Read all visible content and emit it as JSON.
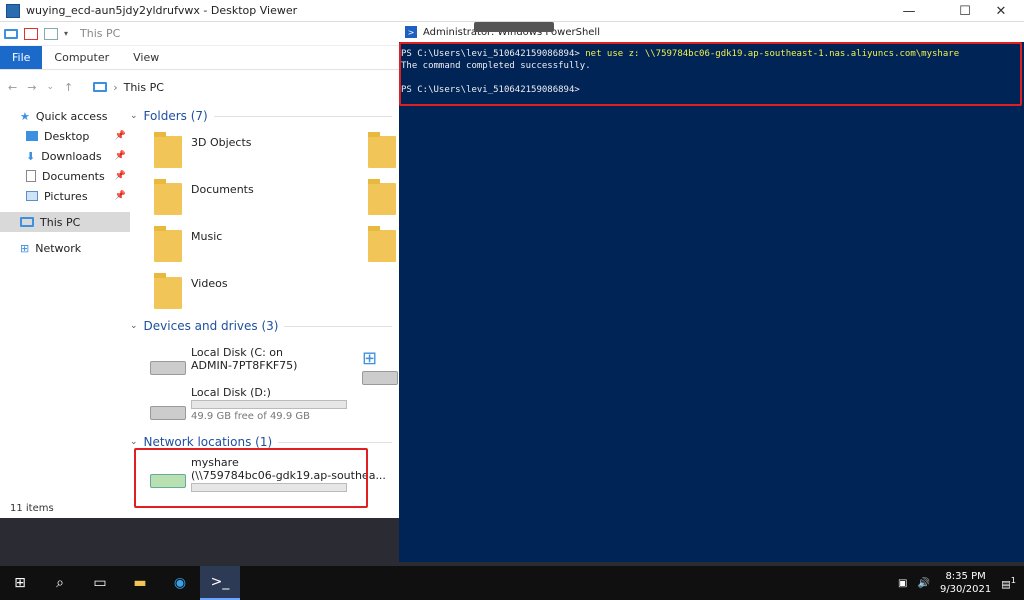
{
  "viewer": {
    "title": "wuying_ecd-aun5jdy2yldrufvwx - Desktop Viewer"
  },
  "explorer": {
    "title": "This PC",
    "ribbon": [
      "File",
      "Computer",
      "View"
    ],
    "address": "This PC",
    "nav": [
      {
        "label": "Quick access",
        "icon": "star-icon",
        "pinned": false
      },
      {
        "label": "Desktop",
        "icon": "desktop-icon",
        "pinned": true
      },
      {
        "label": "Downloads",
        "icon": "download-icon",
        "pinned": true
      },
      {
        "label": "Documents",
        "icon": "documents-icon",
        "pinned": true
      },
      {
        "label": "Pictures",
        "icon": "pictures-icon",
        "pinned": true
      },
      {
        "label": "This PC",
        "icon": "this-pc-icon",
        "pinned": false,
        "selected": true
      },
      {
        "label": "Network",
        "icon": "network-icon",
        "pinned": false
      }
    ],
    "folders_header": "Folders (7)",
    "folders": [
      "3D Objects",
      "Documents",
      "Music",
      "Videos"
    ],
    "devices_header": "Devices and drives (3)",
    "devices": [
      {
        "line1": "Local Disk (C: on",
        "line2": "ADMIN-7PT8FKF75)"
      },
      {
        "line1": "Local Disk (D:)",
        "line2": "49.9 GB free of 49.9 GB",
        "free_fraction": 1.0
      }
    ],
    "network_header": "Network locations (1)",
    "network": {
      "line1": "myshare",
      "line2": "(\\\\759784bc06-gdk19.ap-southea..."
    },
    "status": "11 items"
  },
  "powershell": {
    "title": "Administrator: Windows PowerShell",
    "prompt1": "PS C:\\Users\\levi_510642159086894> ",
    "command": "net use z: \\\\759784bc06-gdk19.ap-southeast-1.nas.aliyuncs.com\\myshare",
    "output": "The command completed successfully.",
    "prompt2": "PS C:\\Users\\levi_510642159086894>"
  },
  "taskbar": {
    "time": "8:35 PM",
    "date": "9/30/2021",
    "notification_count": "1"
  },
  "colors": {
    "ps_bg": "#012456",
    "highlight": "#e02020",
    "file_tab": "#1b6ac9"
  }
}
